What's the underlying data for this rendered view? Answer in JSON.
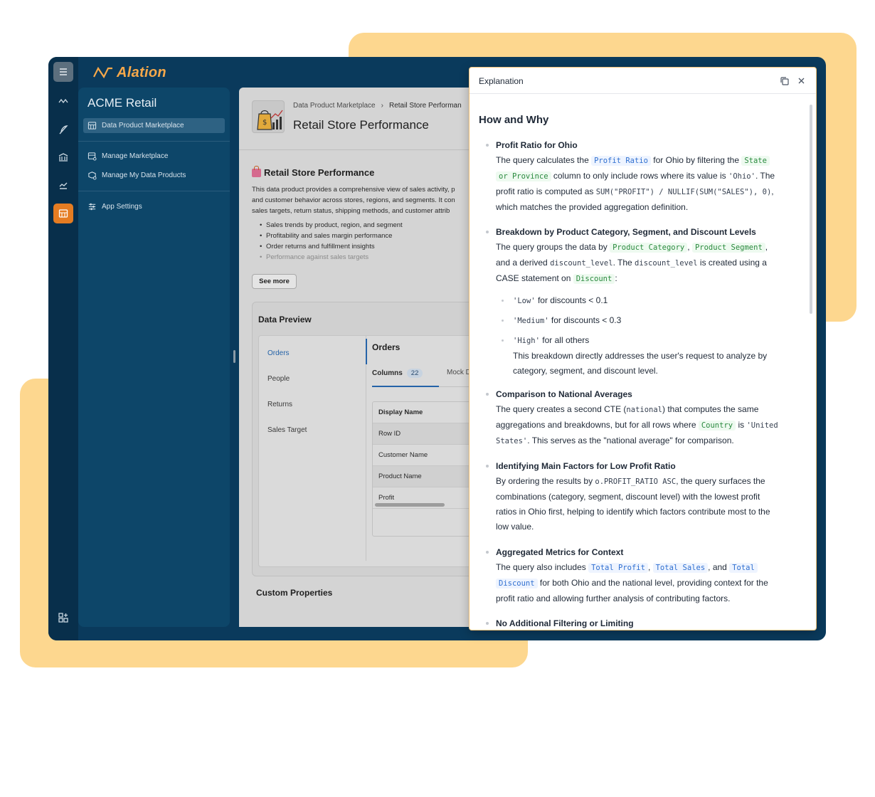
{
  "app": {
    "logo_text": "Alation"
  },
  "nav": {
    "workspace": "ACME Retail",
    "items": [
      {
        "label": "Data Product Marketplace"
      },
      {
        "label": "Manage Marketplace"
      },
      {
        "label": "Manage My Data Products"
      },
      {
        "label": "App Settings"
      }
    ]
  },
  "content": {
    "breadcrumb": [
      "Data Product Marketplace",
      "Retail Store Performan"
    ],
    "title": "Retail Store Performance",
    "section_title": "Retail Store Performance",
    "description": [
      "This data product provides a comprehensive view of sales activity, p",
      "and customer behavior across stores, regions, and segments. It con",
      "sales targets, return status, shipping methods, and customer attrib"
    ],
    "bullets": [
      "Sales trends by product, region, and segment",
      "Profitability and sales margin performance",
      "Order returns and fulfillment insights",
      "Performance against sales targets"
    ],
    "see_more": "See more",
    "preview": {
      "title": "Data Preview",
      "tables": [
        "Orders",
        "People",
        "Returns",
        "Sales Target"
      ],
      "selected_table": "Orders",
      "tabs": {
        "columns_label": "Columns",
        "columns_count": "22",
        "mock_label": "Mock D"
      },
      "grid_header": "Display Name",
      "grid_rows": [
        "Row ID",
        "Customer Name",
        "Product Name",
        "Profit"
      ]
    },
    "custom_properties": "Custom Properties"
  },
  "panel": {
    "title": "Explanation",
    "heading": "How and Why",
    "points": [
      {
        "title": "Profit Ratio for Ohio",
        "l1": [
          "The query calculates the ",
          "Profit Ratio",
          " for Ohio by filtering the ",
          "State"
        ],
        "l2": [
          "or Province",
          " column to only include rows where its value is ",
          "'Ohio'",
          ". The"
        ],
        "l3": [
          "profit ratio is computed as ",
          "SUM(\"PROFIT\") / NULLIF(SUM(\"SALES\"), 0)",
          ","
        ],
        "l4": "which matches the provided aggregation definition."
      },
      {
        "title": "Breakdown by Product Category, Segment, and Discount Levels",
        "l1": [
          "The query groups the data by ",
          "Product Category",
          ", ",
          "Product Segment",
          ","
        ],
        "l2": [
          "and a derived ",
          "discount_level",
          ". The ",
          "discount_level",
          " is created using a"
        ],
        "l3": [
          "CASE statement on ",
          "Discount",
          ":"
        ],
        "sub": [
          [
            "'Low'",
            " for discounts < 0.1"
          ],
          [
            "'Medium'",
            " for discounts < 0.3"
          ],
          [
            "'High'",
            " for all others"
          ]
        ],
        "tail1": "This breakdown directly addresses the user's request to analyze by",
        "tail2": "category, segment, and discount level."
      },
      {
        "title": "Comparison to National Averages",
        "l1": [
          "The query creates a second CTE (",
          "national",
          ") that computes the same"
        ],
        "l2": [
          "aggregations and breakdowns, but for all rows where ",
          "Country",
          " is ",
          "'United"
        ],
        "l3": [
          "States'",
          ". This serves as the \"national average\" for comparison."
        ]
      },
      {
        "title": "Identifying Main Factors for Low Profit Ratio",
        "l1": [
          "By ordering the results by ",
          "o.PROFIT_RATIO ASC",
          ", the query surfaces the"
        ],
        "l2": "combinations (category, segment, discount level) with the lowest profit",
        "l3": "ratios in Ohio first, helping to identify which factors contribute most to the",
        "l4": "low value."
      },
      {
        "title": "Aggregated Metrics for Context",
        "l1": [
          "The query also includes ",
          "Total Profit",
          ", ",
          "Total Sales",
          ", and ",
          "Total"
        ],
        "l2": [
          "Discount",
          " for both Ohio and the national level, providing context for the"
        ],
        "l3": "profit ratio and allowing further analysis of contributing factors."
      },
      {
        "title": "No Additional Filtering or Limiting"
      }
    ]
  }
}
